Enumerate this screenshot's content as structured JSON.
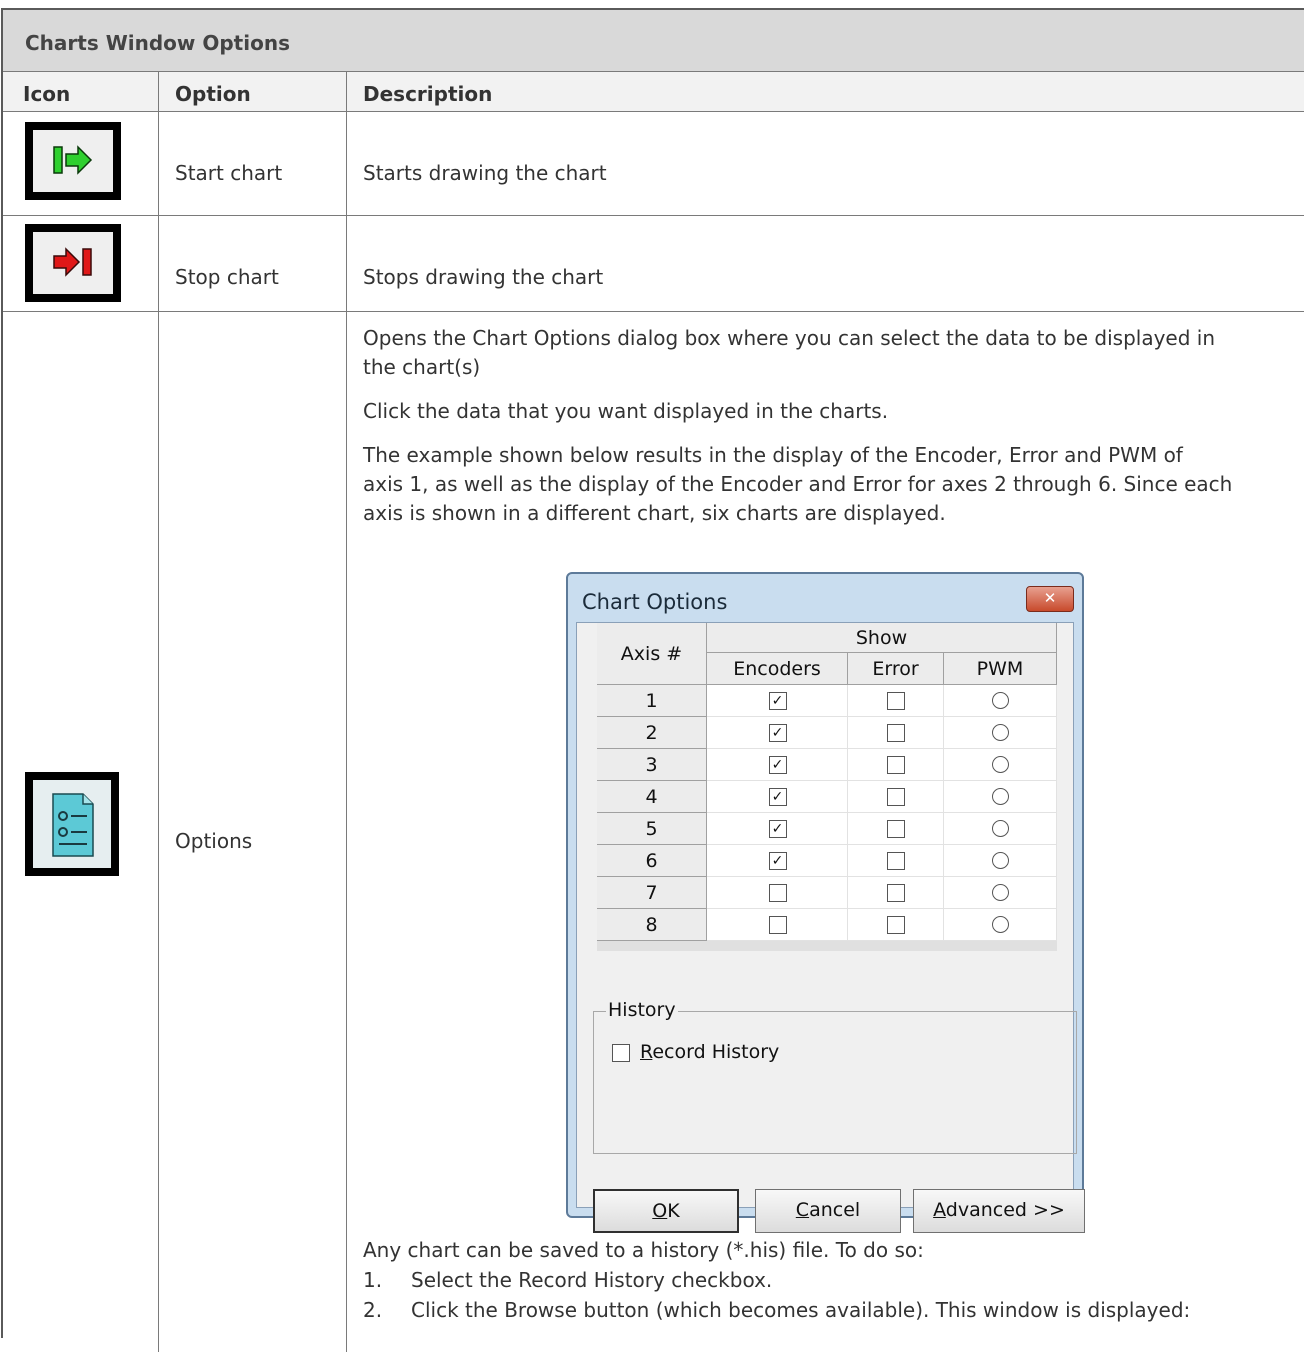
{
  "table": {
    "title": "Charts Window Options",
    "headers": {
      "icon": "Icon",
      "option": "Option",
      "description": "Description"
    },
    "rows": [
      {
        "icon": "start-chart-icon",
        "option": "Start chart",
        "description": "Starts drawing the chart"
      },
      {
        "icon": "stop-chart-icon",
        "option": "Stop chart",
        "description": "Stops drawing the chart"
      },
      {
        "icon": "options-icon",
        "option": "Options",
        "paragraphs": [
          "Opens the Chart Options dialog box where you can select the data to be displayed in",
          "the chart(s)",
          "Click the data that you want displayed in the charts.",
          "The example shown below results in the display of the Encoder, Error and PWM of",
          "axis 1, as well as the display of the Encoder and Error for axes 2 through 6. Since each",
          "axis is shown in a different chart, six charts are displayed."
        ],
        "after_dialog": [
          "Any chart can be saved to a history (*.his) file. To do so:",
          "Select the Record History checkbox.",
          "Click the Browse button (which becomes available). This window is displayed:"
        ],
        "step_numbers": [
          "1.",
          "2."
        ]
      }
    ]
  },
  "dialog": {
    "title": "Chart Options",
    "close_glyph": "✕",
    "header_axis": "Axis #",
    "header_show": "Show",
    "columns": [
      "Encoders",
      "Error",
      "PWM"
    ],
    "axes": [
      {
        "num": "1",
        "encoders": true,
        "error": false,
        "pwm": false
      },
      {
        "num": "2",
        "encoders": true,
        "error": false,
        "pwm": false
      },
      {
        "num": "3",
        "encoders": true,
        "error": false,
        "pwm": false
      },
      {
        "num": "4",
        "encoders": true,
        "error": false,
        "pwm": false
      },
      {
        "num": "5",
        "encoders": true,
        "error": false,
        "pwm": false
      },
      {
        "num": "6",
        "encoders": true,
        "error": false,
        "pwm": false
      },
      {
        "num": "7",
        "encoders": false,
        "error": false,
        "pwm": false
      },
      {
        "num": "8",
        "encoders": false,
        "error": false,
        "pwm": false
      }
    ],
    "history_label": "History",
    "record_history": {
      "label_first": "R",
      "label_rest": "ecord History",
      "checked": false
    },
    "buttons": {
      "ok": {
        "first": "O",
        "rest": "K"
      },
      "cancel": {
        "first": "C",
        "rest": "ancel"
      },
      "advanced": {
        "first": "A",
        "rest": "dvanced >>"
      }
    },
    "check_glyph": "✓"
  }
}
